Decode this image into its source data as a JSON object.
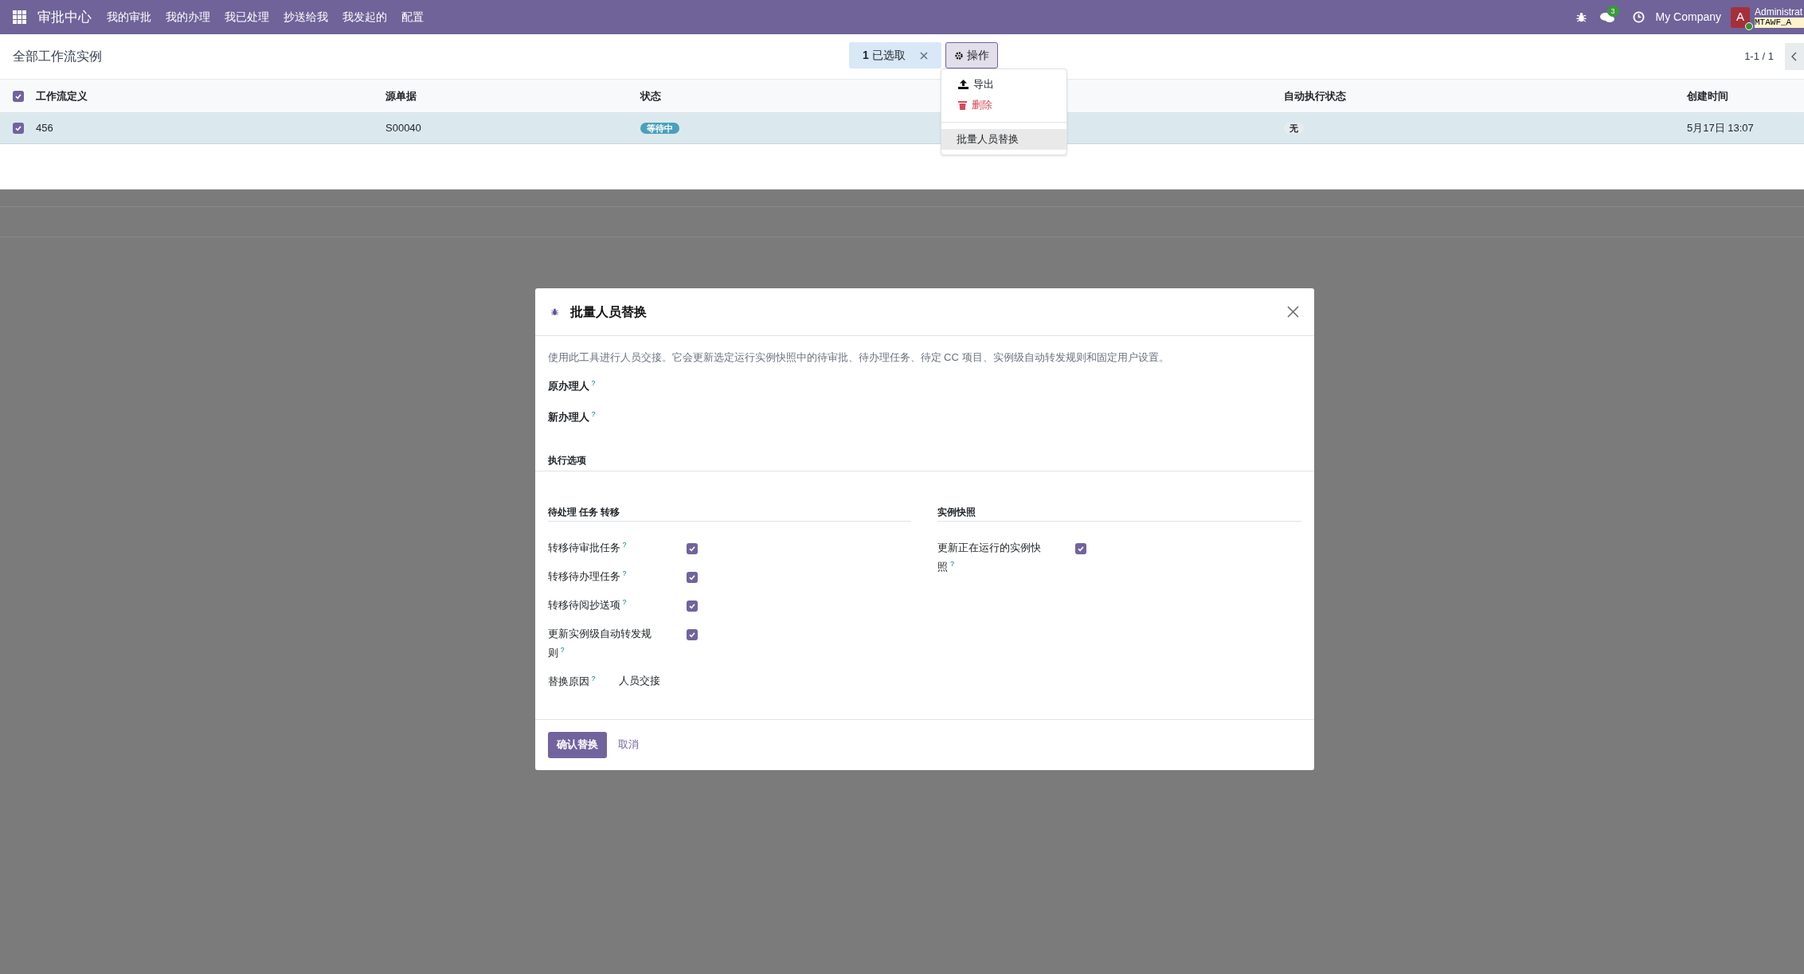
{
  "navbar": {
    "app_title": "审批中心",
    "menu": [
      "我的审批",
      "我的办理",
      "我已处理",
      "抄送给我",
      "我发起的",
      "配置"
    ],
    "messages_badge": "3",
    "company": "My Company",
    "avatar_letter": "A",
    "user_name": "Administrat",
    "db_name": "MTAWF_A"
  },
  "control_panel": {
    "breadcrumb": "全部工作流实例",
    "selection_count": "1",
    "selection_label": "已选取",
    "action_button": "操作",
    "pager": "1-1 / 1"
  },
  "action_menu": {
    "items": [
      {
        "kind": "export",
        "label": "导出",
        "selected": false
      },
      {
        "kind": "delete",
        "label": "删除",
        "selected": false
      },
      {
        "kind": "plain",
        "label": "批量人员替换",
        "selected": true
      }
    ]
  },
  "table": {
    "all_checked": true,
    "columns": [
      "工作流定义",
      "源单据",
      "状态",
      "自动执行状态",
      "创建时间"
    ],
    "rows": [
      {
        "selected": true,
        "definition": "456",
        "source": "S00040",
        "status": "等待中",
        "auto_status": "无",
        "created": "5月17日 13:07"
      }
    ]
  },
  "dialog": {
    "title": "批量人员替换",
    "description": "使用此工具进行人员交接。它会更新选定运行实例快照中的待审批、待办理任务、待定 CC 项目、实例级自动转发规则和固定用户设置。",
    "fields": [
      {
        "label": "原办理人",
        "help": "?"
      },
      {
        "label": "新办理人",
        "help": "?"
      }
    ],
    "section": "执行选项",
    "left_group": {
      "title": "待处理 任务 转移",
      "options": [
        {
          "label": "转移待审批任务",
          "help": "?",
          "checked": true
        },
        {
          "label": "转移待办理任务",
          "help": "?",
          "checked": true
        },
        {
          "label": "转移待阅抄送项",
          "help": "?",
          "checked": true
        },
        {
          "label": "更新实例级自动转发规则",
          "help": "?",
          "checked": true
        }
      ],
      "reason": {
        "label": "替换原因",
        "help": "?",
        "value": "人员交接"
      }
    },
    "right_group": {
      "title": "实例快照",
      "options": [
        {
          "label": "更新正在运行的实例快照",
          "help": "?",
          "checked": true
        }
      ]
    },
    "buttons": [
      {
        "kind": "primary",
        "label": "确认替换"
      },
      {
        "kind": "link",
        "label": "取消"
      }
    ]
  }
}
